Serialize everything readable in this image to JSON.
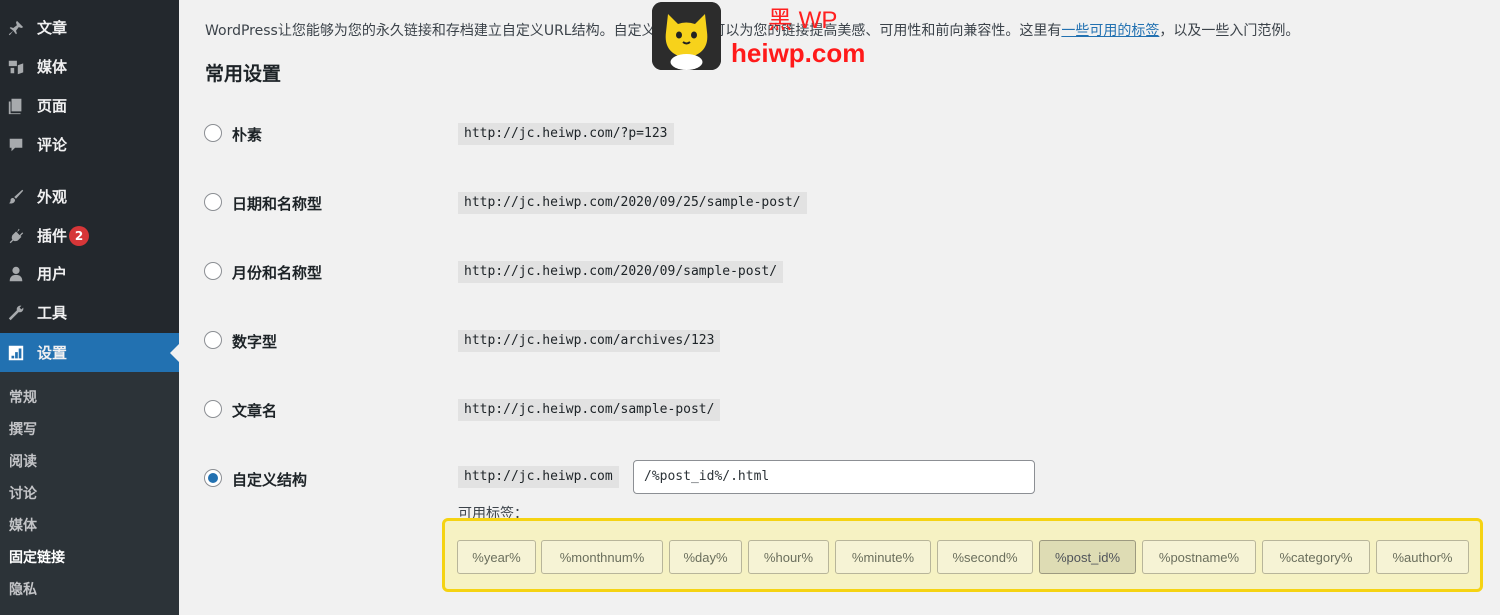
{
  "sidebar": {
    "items": [
      {
        "label": "文章",
        "icon": "pushpin-icon"
      },
      {
        "label": "媒体",
        "icon": "media-icon"
      },
      {
        "label": "页面",
        "icon": "pages-icon"
      },
      {
        "label": "评论",
        "icon": "comment-icon"
      },
      {
        "label": "外观",
        "icon": "paintbrush-icon"
      },
      {
        "label": "插件",
        "icon": "plugin-icon",
        "badge": "2"
      },
      {
        "label": "用户",
        "icon": "user-icon"
      },
      {
        "label": "工具",
        "icon": "wrench-icon"
      },
      {
        "label": "设置",
        "icon": "settings-icon",
        "active": true
      }
    ],
    "submenu": [
      {
        "label": "常规"
      },
      {
        "label": "撰写"
      },
      {
        "label": "阅读"
      },
      {
        "label": "讨论"
      },
      {
        "label": "媒体"
      },
      {
        "label": "固定链接",
        "current": true
      },
      {
        "label": "隐私"
      }
    ]
  },
  "main": {
    "intro_text": "WordPress让您能够为您的永久链接和存档建立自定义URL结构。自定义URL结构可以为您的链接提高美感、可用性和前向兼容性。这里有",
    "intro_link": "一些可用的标签",
    "intro_tail": "，以及一些入门范例。",
    "section_title": "常用设置",
    "options": [
      {
        "label": "朴素",
        "example": "http://jc.heiwp.com/?p=123",
        "checked": false
      },
      {
        "label": "日期和名称型",
        "example": "http://jc.heiwp.com/2020/09/25/sample-post/",
        "checked": false
      },
      {
        "label": "月份和名称型",
        "example": "http://jc.heiwp.com/2020/09/sample-post/",
        "checked": false
      },
      {
        "label": "数字型",
        "example": "http://jc.heiwp.com/archives/123",
        "checked": false
      },
      {
        "label": "文章名",
        "example": "http://jc.heiwp.com/sample-post/",
        "checked": false
      },
      {
        "label": "自定义结构",
        "example": "http://jc.heiwp.com",
        "checked": true
      }
    ],
    "custom_structure_value": "/%post_id%/.html",
    "tags_label": "可用标签：",
    "tags": [
      {
        "label": "%year%"
      },
      {
        "label": "%monthnum%"
      },
      {
        "label": "%day%"
      },
      {
        "label": "%hour%"
      },
      {
        "label": "%minute%"
      },
      {
        "label": "%second%"
      },
      {
        "label": "%post_id%",
        "active": true
      },
      {
        "label": "%postname%"
      },
      {
        "label": "%category%"
      },
      {
        "label": "%author%"
      }
    ]
  },
  "watermark": {
    "title": "黑 WP",
    "url": "heiwp.com"
  },
  "colors": {
    "sidebar_bg": "#23282d",
    "active_bg": "#2271b1",
    "highlight_border": "#f5d312",
    "highlight_bg": "#f6f2c3",
    "badge": "#d63638",
    "watermark_red": "#ff2020"
  }
}
